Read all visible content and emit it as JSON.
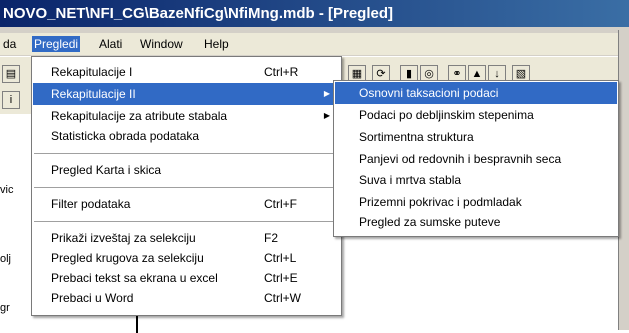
{
  "window": {
    "title": "NOVO_NET\\NFI_CG\\BazeNfiCg\\NfiMng.mdb - [Pregled]"
  },
  "menubar": [
    {
      "label": "da"
    },
    {
      "label": "Pregledi"
    },
    {
      "label": "Alati"
    },
    {
      "label": "Window"
    },
    {
      "label": "Help"
    }
  ],
  "pregledi_menu": {
    "items": [
      {
        "label": "Rekapitulacije I",
        "shortcut": "Ctrl+R"
      },
      {
        "label": "Rekapitulacije II",
        "shortcut": "",
        "submenu": true,
        "highlighted": true
      },
      {
        "label": "Rekapitulacije za atribute stabala",
        "shortcut": "",
        "submenu": true
      },
      {
        "label": "Statisticka obrada podataka",
        "shortcut": ""
      },
      {
        "label": "Pregled Karta i skica",
        "shortcut": ""
      },
      {
        "label": "Filter podataka",
        "shortcut": "Ctrl+F"
      },
      {
        "label": "Prikaži izveštaj za selekciju",
        "shortcut": "F2"
      },
      {
        "label": "Pregled krugova za selekciju",
        "shortcut": "Ctrl+L"
      },
      {
        "label": "Prebaci tekst sa ekrana u excel",
        "shortcut": "Ctrl+E"
      },
      {
        "label": "Prebaci u Word",
        "shortcut": "Ctrl+W"
      }
    ]
  },
  "rekap2_submenu": {
    "items": [
      {
        "label": "Osnovni taksacioni podaci",
        "highlighted": true
      },
      {
        "label": "Podaci po debljinskim stepenima"
      },
      {
        "label": "Sortimentna struktura"
      },
      {
        "label": "Panjevi od redovnih i bespravnih seca"
      },
      {
        "label": "Suva i mrtva stabla"
      },
      {
        "label": "Prizemni pokrivac i podmladak"
      },
      {
        "label": "Pregled za sumske puteve"
      }
    ]
  },
  "background_text": {
    "frag1": "vic",
    "frag2": "olj",
    "frag3": "gr",
    "frag4": "i"
  },
  "colors": {
    "highlight": "#316ac5",
    "titlebar": "#0a246a"
  }
}
